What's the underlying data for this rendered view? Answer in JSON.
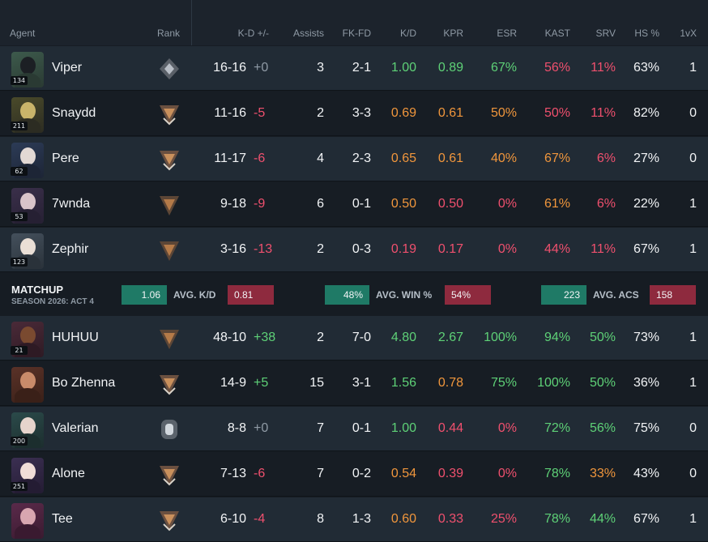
{
  "colors": {
    "positive": "#5ed177",
    "neutral_warning": "#f0963c",
    "negative": "#f0506e",
    "matchup_green": "#1f7a66",
    "matchup_red": "#8e2a3e"
  },
  "header": {
    "agent": "Agent",
    "rank": "Rank",
    "kd_pm": "K-D +/-",
    "assists": "Assists",
    "fkfd": "FK-FD",
    "kd": "K/D",
    "kpr": "KPR",
    "esr": "ESR",
    "kast": "KAST",
    "srv": "SRV",
    "hs": "HS %",
    "onevx": "1vX"
  },
  "team1": [
    {
      "name": "Viper",
      "level": "134",
      "rank_icon": "iron-diamond-rank-icon",
      "kd": "16-16",
      "pm": "+0",
      "pm_color": "grey",
      "assists": "3",
      "fkfd": "2-1",
      "kdr": "1.00",
      "kdr_color": "green",
      "kpr": "0.89",
      "kpr_color": "green",
      "esr": "67%",
      "esr_color": "green",
      "kast": "56%",
      "kast_color": "red",
      "srv": "11%",
      "srv_color": "red",
      "hs": "63%",
      "onevx": "1"
    },
    {
      "name": "Snaydd",
      "level": "211",
      "rank_icon": "bronze-chevron-rank-icon",
      "kd": "11-16",
      "pm": "-5",
      "pm_color": "red",
      "assists": "2",
      "fkfd": "3-3",
      "kdr": "0.69",
      "kdr_color": "orange",
      "kpr": "0.61",
      "kpr_color": "orange",
      "esr": "50%",
      "esr_color": "orange",
      "kast": "50%",
      "kast_color": "red",
      "srv": "11%",
      "srv_color": "red",
      "hs": "82%",
      "onevx": "0"
    },
    {
      "name": "Pere",
      "level": "62",
      "rank_icon": "bronze-chevron-rank-icon",
      "kd": "11-17",
      "pm": "-6",
      "pm_color": "red",
      "assists": "4",
      "fkfd": "2-3",
      "kdr": "0.65",
      "kdr_color": "orange",
      "kpr": "0.61",
      "kpr_color": "orange",
      "esr": "40%",
      "esr_color": "orange",
      "kast": "67%",
      "kast_color": "orange",
      "srv": "6%",
      "srv_color": "red",
      "hs": "27%",
      "onevx": "0"
    },
    {
      "name": "7wnda",
      "level": "53",
      "rank_icon": "bronze-triangle-rank-icon",
      "kd": "9-18",
      "pm": "-9",
      "pm_color": "red",
      "assists": "6",
      "fkfd": "0-1",
      "kdr": "0.50",
      "kdr_color": "orange",
      "kpr": "0.50",
      "kpr_color": "red",
      "esr": "0%",
      "esr_color": "red",
      "kast": "61%",
      "kast_color": "orange",
      "srv": "6%",
      "srv_color": "red",
      "hs": "22%",
      "onevx": "1"
    },
    {
      "name": "Zephir",
      "level": "123",
      "rank_icon": "bronze-triangle-rank-icon",
      "kd": "3-16",
      "pm": "-13",
      "pm_color": "red",
      "assists": "2",
      "fkfd": "0-3",
      "kdr": "0.19",
      "kdr_color": "red",
      "kpr": "0.17",
      "kpr_color": "red",
      "esr": "0%",
      "esr_color": "red",
      "kast": "44%",
      "kast_color": "red",
      "srv": "11%",
      "srv_color": "red",
      "hs": "67%",
      "onevx": "1"
    }
  ],
  "matchup": {
    "title": "MATCHUP",
    "season": "SEASON 2026: ACT 4",
    "kd_left": "1.06",
    "kd_label": "AVG. K/D",
    "kd_right": "0.81",
    "win_left": "48%",
    "win_label": "AVG. WIN %",
    "win_right": "54%",
    "acs_left": "223",
    "acs_label": "AVG. ACS",
    "acs_right": "158"
  },
  "team2": [
    {
      "name": "HUHUU",
      "level": "21",
      "rank_icon": "bronze-triangle-rank-icon",
      "kd": "48-10",
      "pm": "+38",
      "pm_color": "green",
      "assists": "2",
      "fkfd": "7-0",
      "kdr": "4.80",
      "kdr_color": "green",
      "kpr": "2.67",
      "kpr_color": "green",
      "esr": "100%",
      "esr_color": "green",
      "kast": "94%",
      "kast_color": "green",
      "srv": "50%",
      "srv_color": "green",
      "hs": "73%",
      "onevx": "1"
    },
    {
      "name": "Bo Zhenna",
      "level": "",
      "rank_icon": "bronze-chevron-rank-icon",
      "kd": "14-9",
      "pm": "+5",
      "pm_color": "green",
      "assists": "15",
      "fkfd": "3-1",
      "kdr": "1.56",
      "kdr_color": "green",
      "kpr": "0.78",
      "kpr_color": "orange",
      "esr": "75%",
      "esr_color": "green",
      "kast": "100%",
      "kast_color": "green",
      "srv": "50%",
      "srv_color": "green",
      "hs": "36%",
      "onevx": "1"
    },
    {
      "name": "Valerian",
      "level": "200",
      "rank_icon": "silver-circle-rank-icon",
      "kd": "8-8",
      "pm": "+0",
      "pm_color": "grey",
      "assists": "7",
      "fkfd": "0-1",
      "kdr": "1.00",
      "kdr_color": "green",
      "kpr": "0.44",
      "kpr_color": "red",
      "esr": "0%",
      "esr_color": "red",
      "kast": "72%",
      "kast_color": "green",
      "srv": "56%",
      "srv_color": "green",
      "hs": "75%",
      "onevx": "0"
    },
    {
      "name": "Alone",
      "level": "251",
      "rank_icon": "bronze-chevron-rank-icon",
      "kd": "7-13",
      "pm": "-6",
      "pm_color": "red",
      "assists": "7",
      "fkfd": "0-2",
      "kdr": "0.54",
      "kdr_color": "orange",
      "kpr": "0.39",
      "kpr_color": "red",
      "esr": "0%",
      "esr_color": "red",
      "kast": "78%",
      "kast_color": "green",
      "srv": "33%",
      "srv_color": "orange",
      "hs": "43%",
      "onevx": "0"
    },
    {
      "name": "Tee",
      "level": "",
      "rank_icon": "bronze-chevron-rank-icon",
      "kd": "6-10",
      "pm": "-4",
      "pm_color": "red",
      "assists": "8",
      "fkfd": "1-3",
      "kdr": "0.60",
      "kdr_color": "orange",
      "kpr": "0.33",
      "kpr_color": "red",
      "esr": "25%",
      "esr_color": "red",
      "kast": "78%",
      "kast_color": "green",
      "srv": "44%",
      "srv_color": "green",
      "hs": "67%",
      "onevx": "1"
    }
  ]
}
